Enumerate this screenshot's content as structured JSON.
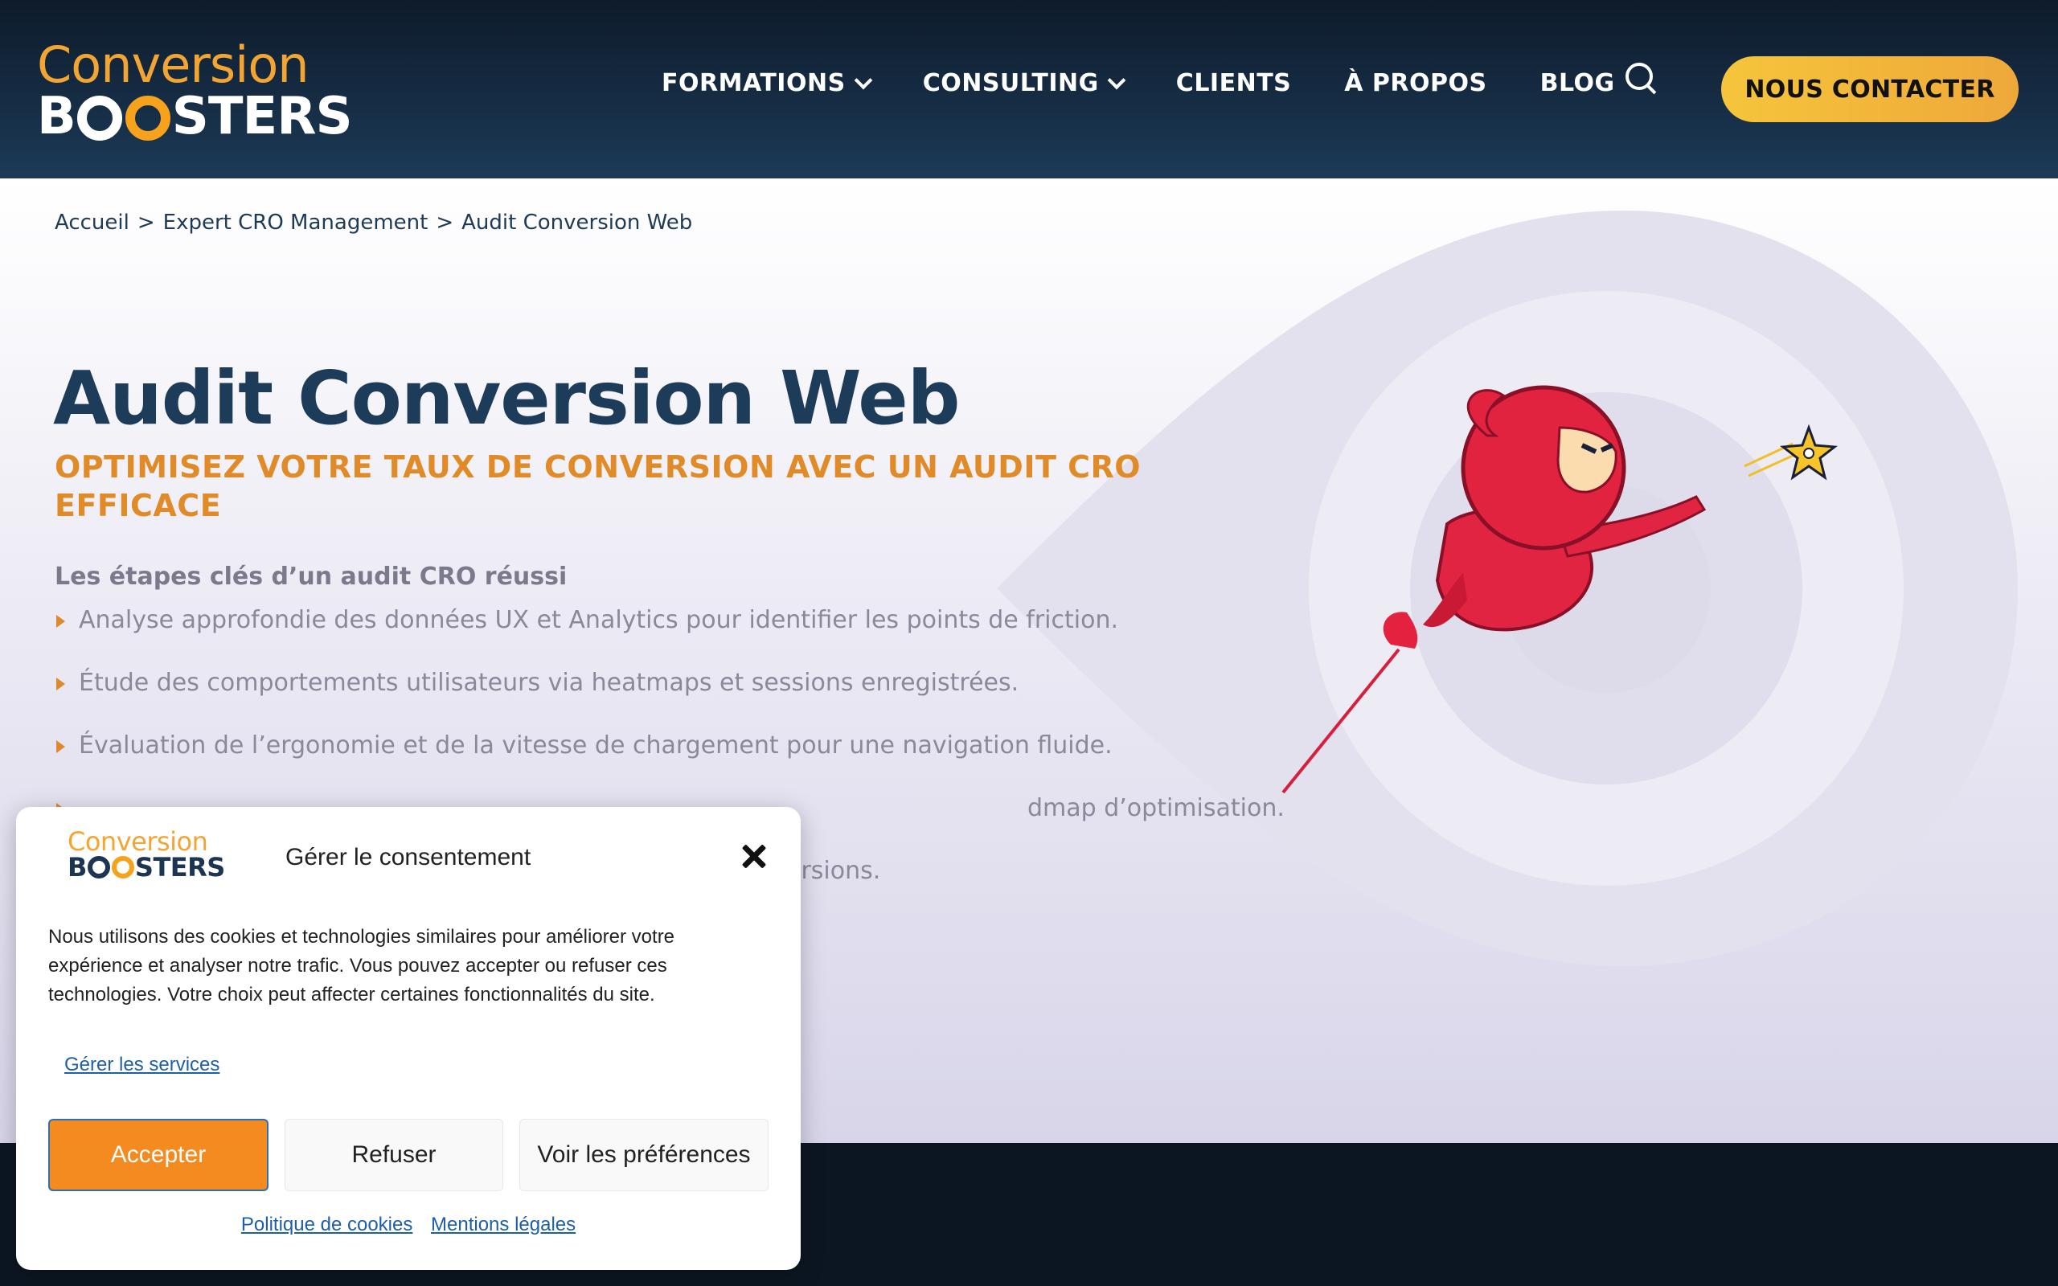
{
  "header": {
    "logo_top": "Conversion",
    "logo_bottom_1": "B",
    "logo_bottom_2": "STERS",
    "nav": [
      {
        "label": "FORMATIONS",
        "has_dropdown": true
      },
      {
        "label": "CONSULTING",
        "has_dropdown": true
      },
      {
        "label": "CLIENTS",
        "has_dropdown": false
      },
      {
        "label": "À PROPOS",
        "has_dropdown": false
      },
      {
        "label": "BLOG",
        "has_dropdown": false
      }
    ],
    "cta_label": "NOUS CONTACTER",
    "search_icon": "search-icon"
  },
  "breadcrumb": {
    "items": [
      "Accueil",
      "Expert CRO Management",
      "Audit Conversion Web"
    ],
    "separator": ">"
  },
  "hero": {
    "title": "Audit Conversion Web",
    "subtitle": "OPTIMISEZ VOTRE TAUX DE CONVERSION AVEC UN AUDIT CRO EFFICACE",
    "steps_title": "Les étapes clés d’un audit CRO réussi",
    "steps": [
      "Analyse approfondie des données UX et Analytics pour identifier les points de friction.",
      "Étude des comportements utilisateurs via heatmaps et sessions enregistrées.",
      "Évaluation de l’ergonomie et de la vitesse de chargement pour une navigation fluide.",
      "dmap d’optimisation.",
      "ersions."
    ]
  },
  "cookie_modal": {
    "logo_top": "Conversion",
    "logo_bottom_1": "B",
    "logo_bottom_2": "STERS",
    "title": "Gérer le consentement",
    "text": "Nous utilisons des cookies et technologies similaires pour améliorer votre expérience et analyser notre trafic. Vous pouvez accepter ou refuser ces technologies. Votre choix peut affecter certaines fonctionnalités du site.",
    "manage_link": "Gérer les services",
    "accept": "Accepter",
    "refuse": "Refuser",
    "preferences": "Voir les préférences",
    "cookie_policy": "Politique de cookies",
    "legal": "Mentions légales"
  },
  "colors": {
    "header_dark": "#0e1b2b",
    "accent_orange": "#e08a28",
    "cta_yellow": "#f6c53b",
    "title_navy": "#1d3c5a",
    "accept_orange": "#f38b21"
  }
}
